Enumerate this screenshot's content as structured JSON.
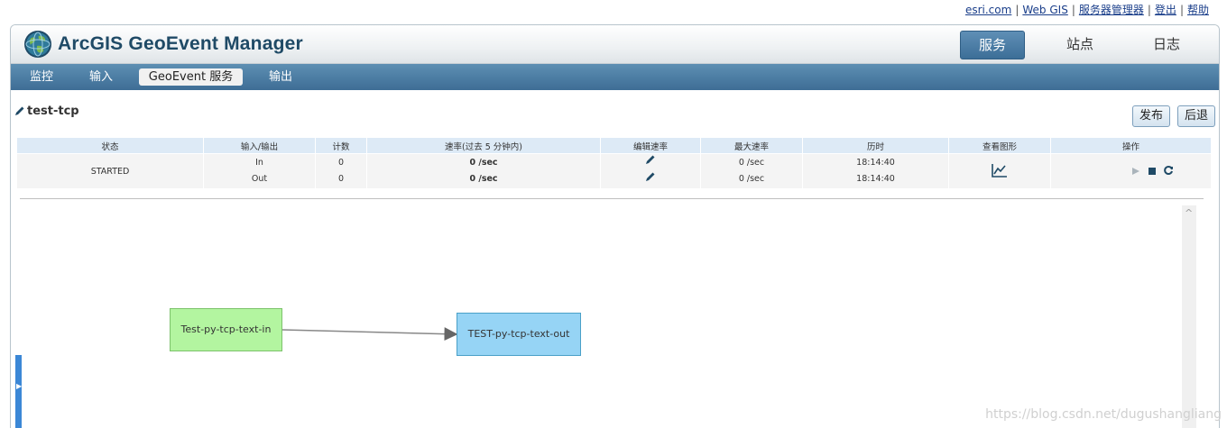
{
  "top_links": [
    "esri.com",
    "Web GIS",
    "服务器管理器",
    "登出",
    "帮助"
  ],
  "app": {
    "title": "ArcGIS GeoEvent Manager"
  },
  "top_nav": [
    "服务",
    "站点",
    "日志"
  ],
  "sub_nav": [
    "监控",
    "输入",
    "GeoEvent 服务",
    "输出"
  ],
  "page": {
    "title": "test-tcp",
    "publish": "发布",
    "back": "后退"
  },
  "table": {
    "headers": [
      "状态",
      "输入/输出",
      "计数",
      "速率(过去 5 分钟内)",
      "编辑速率",
      "最大速率",
      "历时",
      "查看图形",
      "操作"
    ],
    "status": "STARTED",
    "rows": [
      {
        "io": "In",
        "count": "0",
        "rate": "0 /sec",
        "max_rate": "0 /sec",
        "time": "18:14:40"
      },
      {
        "io": "Out",
        "count": "0",
        "rate": "0 /sec",
        "max_rate": "0 /sec",
        "time": "18:14:40"
      }
    ]
  },
  "diagram": {
    "input_node": "Test-py-tcp-text-in",
    "output_node": "TEST-py-tcp-text-out"
  },
  "watermark": "https://blog.csdn.net/dugushangliang",
  "colors": {
    "accent": "#3e6d95",
    "started": "#2a9a2a",
    "input_node": "#b3f5a0",
    "output_node": "#96d4f5"
  }
}
